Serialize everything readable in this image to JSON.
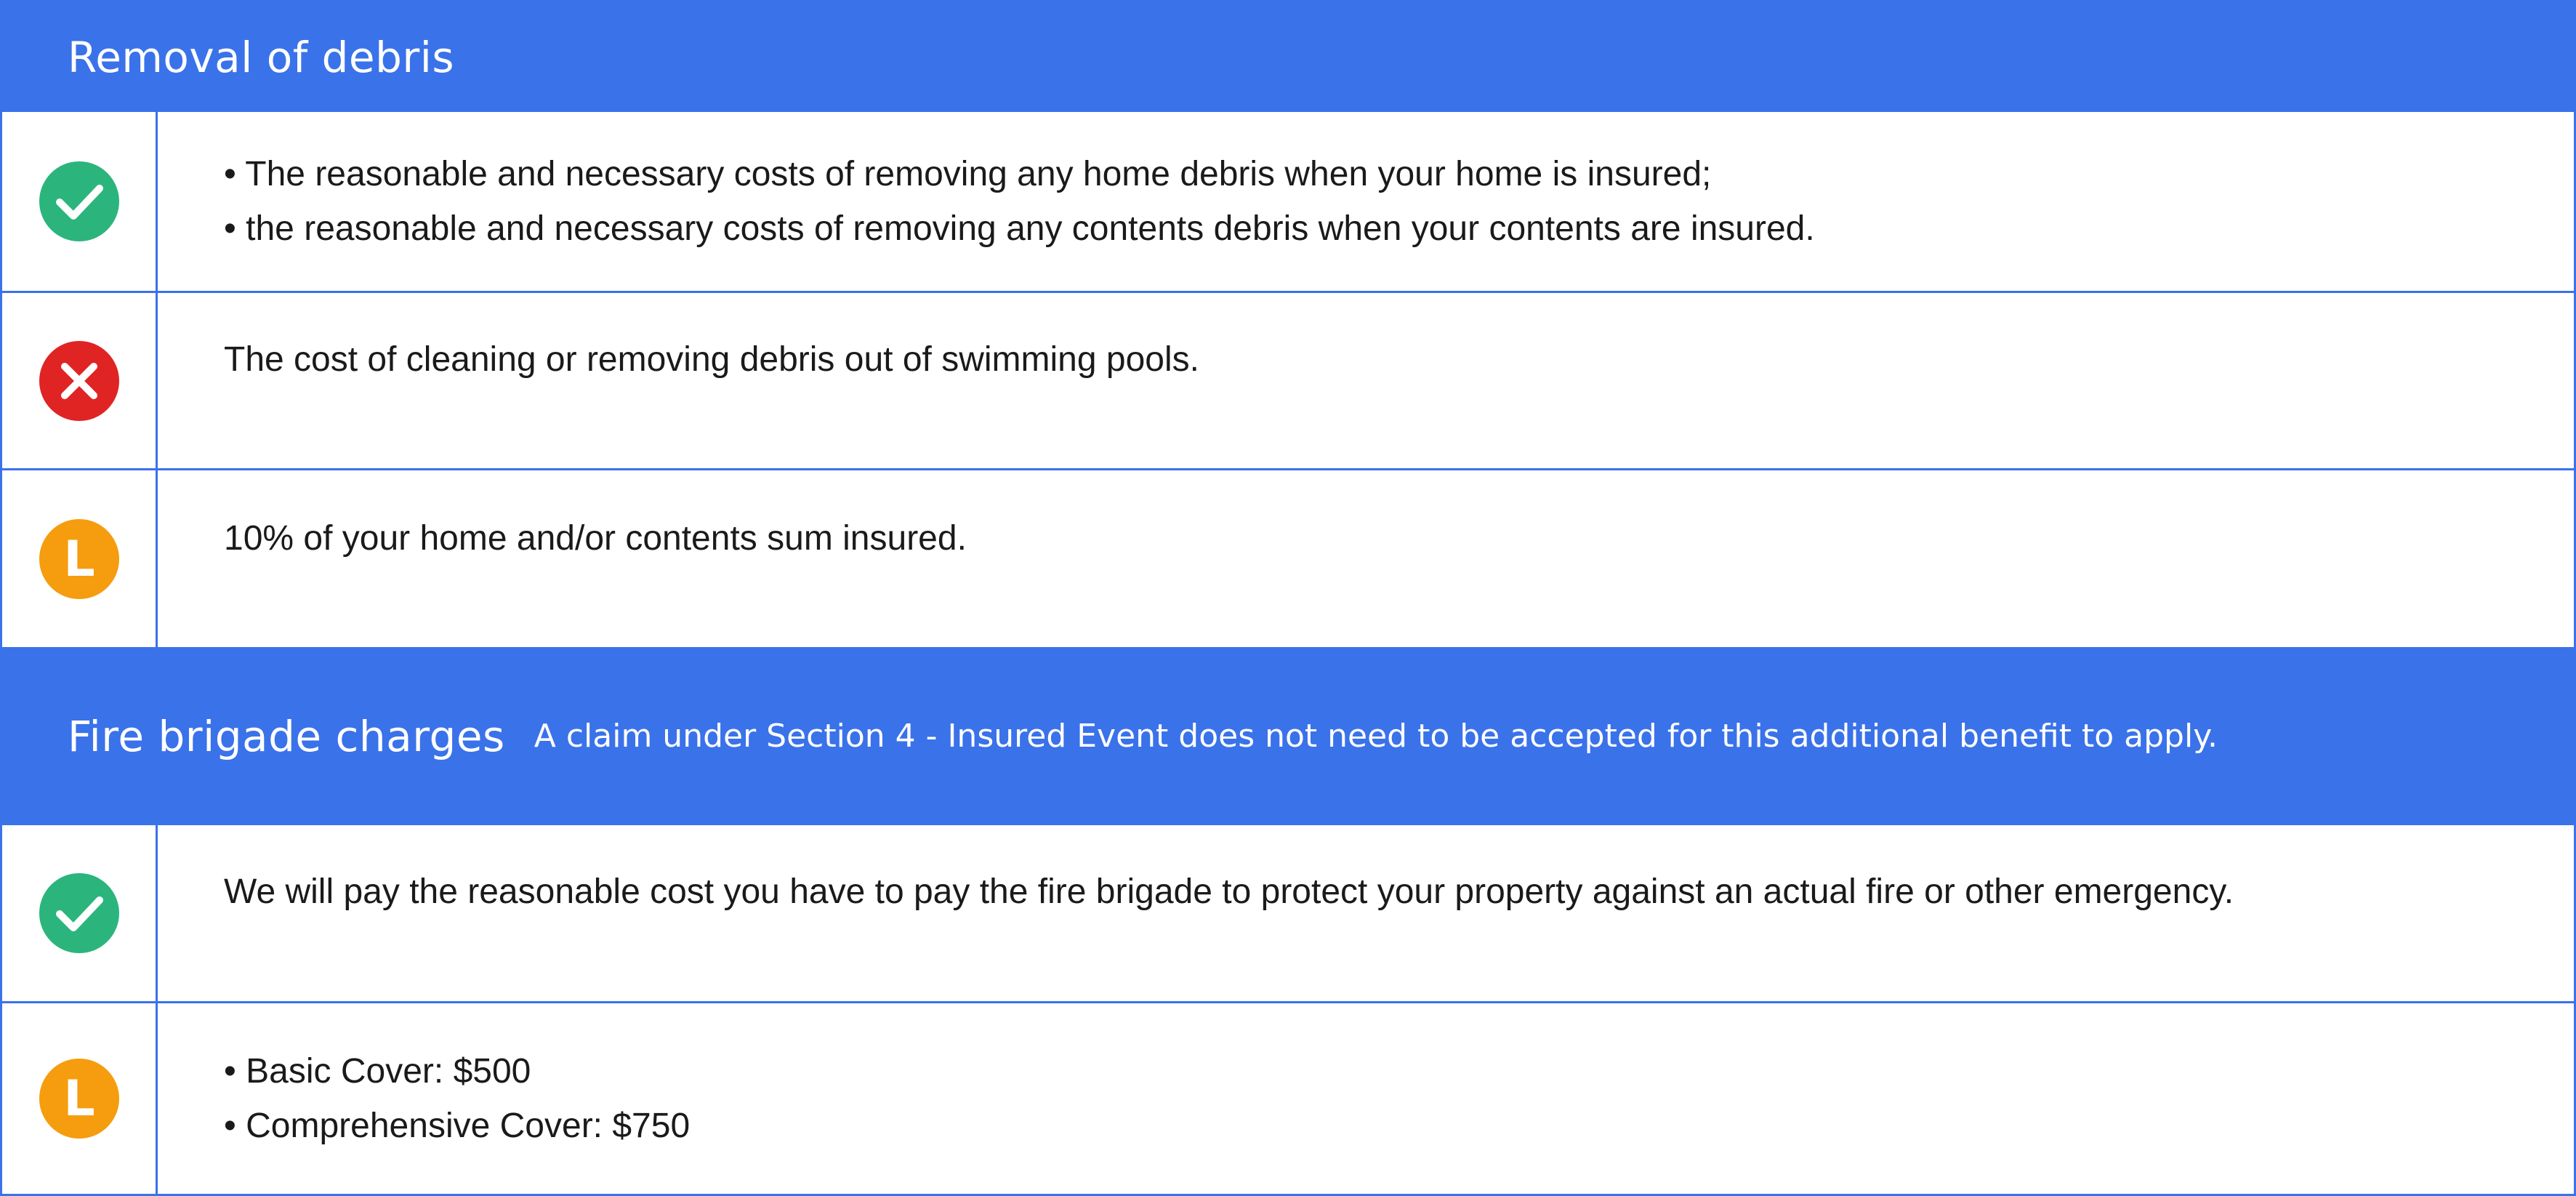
{
  "sections": [
    {
      "title": "Removal of debris",
      "note": "",
      "rows": [
        {
          "icon": "check-icon",
          "color": "#2bb57d",
          "lines": [
            "• The reasonable and necessary costs of removing any home debris when your home is insured;",
            "• the reasonable and necessary costs of removing any contents debris when your contents are insured."
          ]
        },
        {
          "icon": "cross-icon",
          "color": "#e02424",
          "lines": [
            "The cost of cleaning or removing debris out of swimming pools."
          ]
        },
        {
          "icon": "limit-icon",
          "color": "#f59d0e",
          "letter": "L",
          "lines": [
            "10% of your home and/or contents sum insured."
          ]
        }
      ]
    },
    {
      "title": "Fire brigade charges",
      "note": "A claim under Section 4 - Insured Event does not need to be accepted for this additional benefit to apply.",
      "rows": [
        {
          "icon": "check-icon",
          "color": "#2bb57d",
          "lines": [
            "We will pay the reasonable cost you have to pay the fire brigade to protect your property against an actual fire or other emergency."
          ]
        },
        {
          "icon": "limit-icon",
          "color": "#f59d0e",
          "letter": "L",
          "lines": [
            "• Basic Cover: $500",
            "• Comprehensive Cover: $750"
          ]
        }
      ]
    }
  ],
  "colors": {
    "header_bg": "#3a72ea",
    "border": "#3a72ea",
    "covered": "#2bb57d",
    "not_covered": "#e02424",
    "limit": "#f59d0e"
  }
}
